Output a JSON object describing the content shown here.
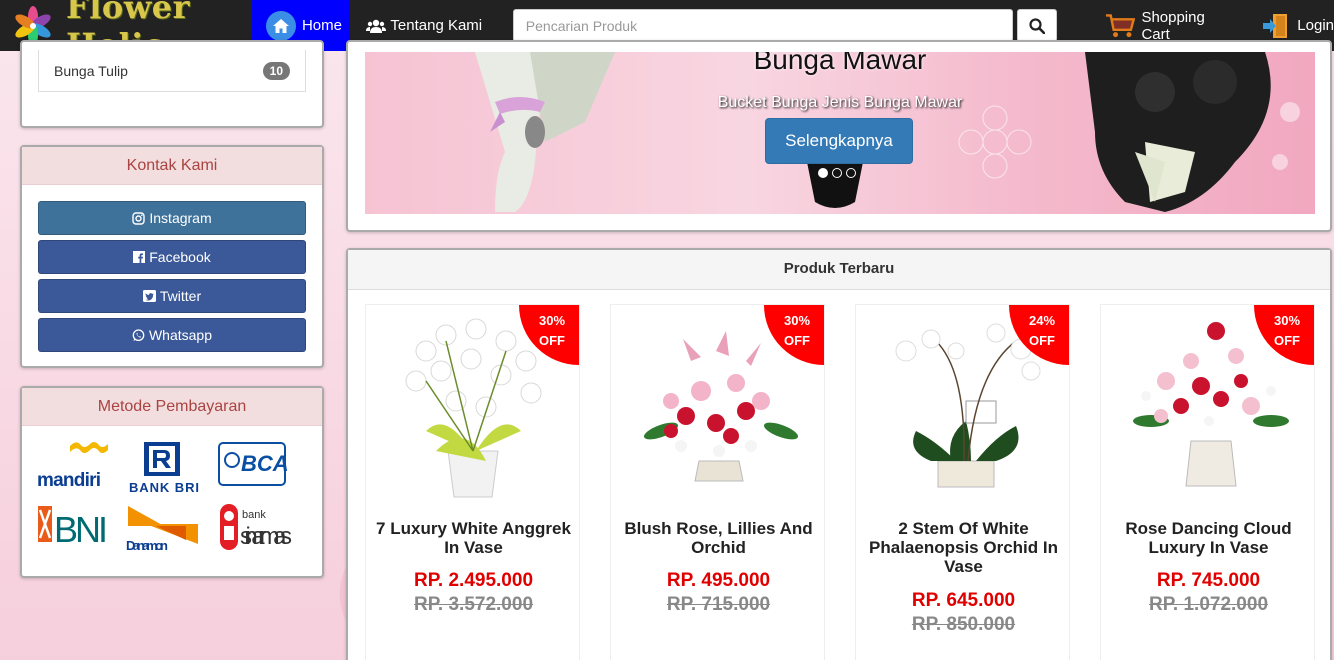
{
  "brand": {
    "name": "Flower Holic"
  },
  "nav": {
    "home": "Home",
    "about": "Tentang Kami",
    "cart": "Shopping Cart",
    "login": "Login"
  },
  "search": {
    "placeholder": "Pencarian Produk"
  },
  "sidebar": {
    "category_item": {
      "label": "Bunga Tulip",
      "count": "10"
    },
    "contact": {
      "title": "Kontak Kami",
      "buttons": [
        {
          "label": "Instagram",
          "color": "#3f729b"
        },
        {
          "label": "Facebook",
          "color": "#3b5998"
        },
        {
          "label": "Twitter",
          "color": "#3b5998"
        },
        {
          "label": "Whatsapp",
          "color": "#3b5998"
        }
      ]
    },
    "payment": {
      "title": "Metode Pembayaran",
      "banks": [
        "mandiri",
        "BANK BRI",
        "BCA",
        "BNI",
        "Danamon",
        "sinarmas"
      ]
    }
  },
  "hero": {
    "title": "Bunga Mawar",
    "subtitle": "Bucket Bunga Jenis Bunga Mawar",
    "button": "Selengkapnya",
    "slides": 3,
    "active_slide": 1
  },
  "products": {
    "title": "Produk Terbaru",
    "items": [
      {
        "discount": "30%",
        "off": "OFF",
        "name": "7 Luxury White Anggrek In Vase",
        "price": "RP. 2.495.000",
        "old_price": "RP. 3.572.000"
      },
      {
        "discount": "30%",
        "off": "OFF",
        "name": "Blush Rose, Lillies And Orchid",
        "price": "RP. 495.000",
        "old_price": "RP. 715.000"
      },
      {
        "discount": "24%",
        "off": "OFF",
        "name": "2 Stem Of White Phalaenopsis Orchid In Vase",
        "price": "RP. 645.000",
        "old_price": "RP. 850.000"
      },
      {
        "discount": "30%",
        "off": "OFF",
        "name": "Rose Dancing Cloud Luxury In Vase",
        "price": "RP. 745.000",
        "old_price": "RP. 1.072.000"
      }
    ]
  }
}
